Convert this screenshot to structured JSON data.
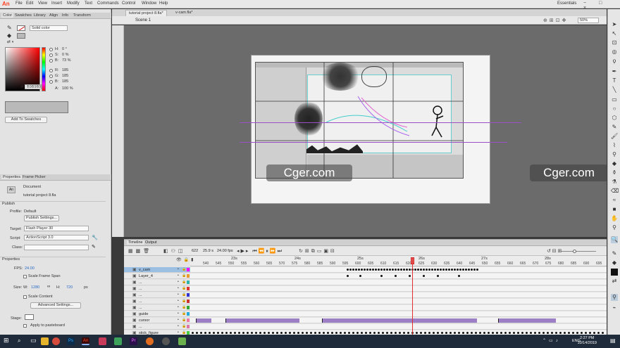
{
  "app": {
    "logo": "An",
    "menu": [
      "File",
      "Edit",
      "View",
      "Insert",
      "Modify",
      "Text",
      "Commands",
      "Control",
      "Window",
      "Help"
    ],
    "workspace": "Essentials",
    "window_controls": "− □ ×"
  },
  "doc_tabs": [
    {
      "label": "tutorial project 8.fla*",
      "active": true
    },
    {
      "label": "v-cam.fla*",
      "active": false
    }
  ],
  "scene": {
    "label": "Scene 1",
    "zoom": "50%"
  },
  "color_panel": {
    "tabs": [
      "Color",
      "Swatches",
      "Library",
      "Align",
      "Info",
      "Transform"
    ],
    "fill_type": "Solid color",
    "hsb": [
      {
        "k": "H:",
        "v": "0 °"
      },
      {
        "k": "S:",
        "v": "0 %"
      },
      {
        "k": "B:",
        "v": "73 %"
      }
    ],
    "rgb": [
      {
        "k": "R:",
        "v": "185"
      },
      {
        "k": "G:",
        "v": "185"
      },
      {
        "k": "B:",
        "v": "185"
      }
    ],
    "alpha": {
      "k": "A:",
      "v": "100 %"
    },
    "hex": "B9B9B9",
    "add_swatch": "Add To Swatches"
  },
  "properties": {
    "tabs": [
      "Properties",
      "Frame Picker"
    ],
    "doc_label": "Document",
    "doc_name": "tutorial project 8.fla",
    "publish_head": "Publish",
    "profile_label": "Profile:",
    "profile_value": "Default",
    "publish_settings": "Publish Settings...",
    "target_label": "Target:",
    "target_value": "Flash Player 30",
    "script_label": "Script:",
    "script_value": "ActionScript 3.0",
    "class_label": "Class:",
    "props_head": "Properties",
    "fps_label": "FPS:",
    "fps_value": "24.00",
    "scale_frame_span": "Scale Frame Span",
    "size_label": "Size:",
    "w_label": "W:",
    "w_value": "1280",
    "h_label": "H:",
    "h_value": "720",
    "px": "px",
    "scale_content": "Scale Content",
    "advanced": "Advanced Settings...",
    "stage_label": "Stage:",
    "apply_pasteboard": "Apply to pasteboard"
  },
  "timeline": {
    "tabs": [
      "Timeline",
      "Output"
    ],
    "frame": "622",
    "fps": "25.9 s",
    "rate": "24.00 fps",
    "second_marks": [
      "23s",
      "24s",
      "25s",
      "26s",
      "27s",
      "28s"
    ],
    "ruler": [
      "540",
      "545",
      "550",
      "555",
      "560",
      "565",
      "570",
      "575",
      "580",
      "585",
      "590",
      "595",
      "600",
      "605",
      "610",
      "615",
      "620",
      "625",
      "630",
      "635",
      "640",
      "645",
      "650",
      "655",
      "660",
      "665",
      "670",
      "675",
      "680",
      "685",
      "690",
      "695"
    ],
    "layers": [
      "v_cam",
      "Layer_4",
      "...",
      "...",
      "...",
      "...",
      "...",
      "guide",
      "cursor",
      "...",
      "stick_figure"
    ]
  },
  "watermarks": [
    "Cger.com",
    "Cger.com"
  ],
  "taskbar": {
    "lang": "ENG",
    "time": "2:27 PM",
    "date": "10/14/2019"
  }
}
